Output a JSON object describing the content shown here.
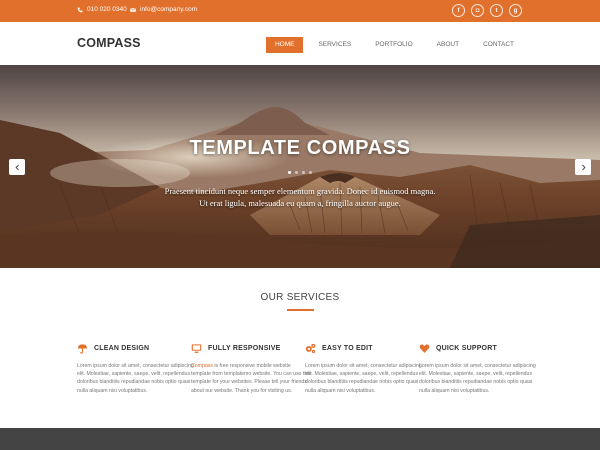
{
  "colors": {
    "accent": "#e2702d",
    "footer": "#444444",
    "text": "#777777"
  },
  "topbar": {
    "phone": "010 020 0340",
    "email": "info@company.com",
    "socials": [
      {
        "icon": "facebook-icon",
        "glyph": "f"
      },
      {
        "icon": "instagram-icon",
        "glyph": "◘"
      },
      {
        "icon": "twitter-icon",
        "glyph": "t"
      },
      {
        "icon": "google-plus-icon",
        "glyph": "g"
      }
    ]
  },
  "header": {
    "logo": "COMPASS",
    "nav": [
      "HOME",
      "SERVICES",
      "PORTFOLIO",
      "ABOUT",
      "CONTACT"
    ],
    "active": "HOME"
  },
  "hero": {
    "title": "TEMPLATE COMPASS",
    "subtitle_line1": "Praesent tincidunt neque semper elementum gravida. Donec id euismod magna.",
    "subtitle_line2": "Ut erat ligula, malesuada eu quam a, fringilla auctor augue.",
    "slide_count": 4,
    "active_slide": 1
  },
  "services": {
    "title": "OUR SERVICES",
    "items": [
      {
        "name": "CLEAN DESIGN",
        "icon": "umbrella-icon",
        "text": "Lorem ipsum dolor sit amet, consectetur adipiscing elit. Molestiae, sapiente, saepe, velit, repellendus doloribus blanditiis repudiandae nobis optio quasi nulla aliquam nisi voluptatibus."
      },
      {
        "name": "FULLY RESPONSIVE",
        "icon": "desktop-icon",
        "text_link": "Compass",
        "text": " is free responsive mobile website template from templatemo website. You can use this template for your websites. Please tell your friends about our website. Thank you for visiting us."
      },
      {
        "name": "EASY TO EDIT",
        "icon": "gears-icon",
        "text": "Lorem ipsum dolor sit amet, consectetur adipiscing elit. Molestiae, sapiente, saepe, velit, repellendus doloribus blanditiis repudiandae nobis optio quasi nulla aliquam nisi voluptatibus."
      },
      {
        "name": "QUICK SUPPORT",
        "icon": "heart-icon",
        "text": "Lorem ipsum dolor sit amet, consectetur adipiscing elit. Molestiae, sapiente, saepe, velit, repellendus doloribus blanditiis repudiandae nobis optio quasi nulla aliquam nisi voluptatibus."
      }
    ]
  }
}
